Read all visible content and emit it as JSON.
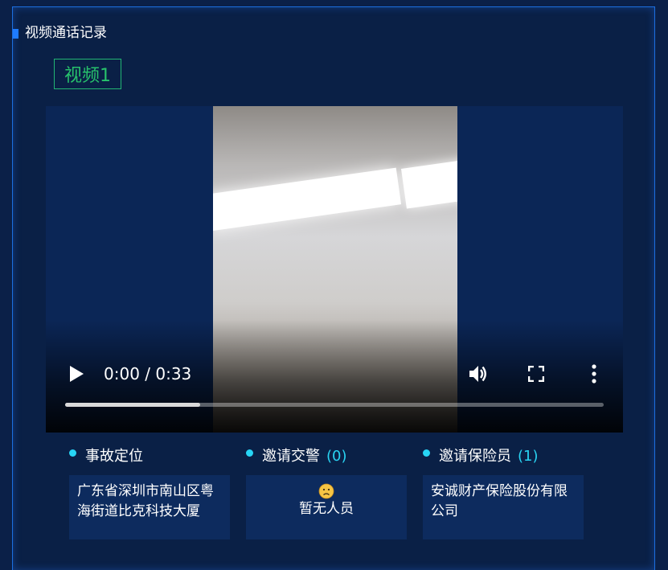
{
  "panel": {
    "title": "视频通话记录"
  },
  "video_tab": {
    "label": "视频1"
  },
  "player": {
    "time_display": "0:00 / 0:33",
    "progress": 0.25,
    "icons": {
      "play": "play-icon",
      "volume": "volume-icon",
      "fullscreen": "fullscreen-icon",
      "more": "more-vertical-icon"
    }
  },
  "info": {
    "location": {
      "label": "事故定位",
      "value": "广东省深圳市南山区粤海街道比克科技大厦"
    },
    "police": {
      "label": "邀请交警",
      "count": "(0)",
      "empty_text": "暂无人员",
      "empty_icon": "sad-face-icon"
    },
    "insurer": {
      "label": "邀请保险员",
      "count": "(1)",
      "value": "安诚财产保险股份有限公司"
    }
  },
  "colors": {
    "background": "#0a2046",
    "border": "#1c6fe0",
    "accent_cyan": "#29d3f2",
    "tab_green": "#27c26c"
  }
}
